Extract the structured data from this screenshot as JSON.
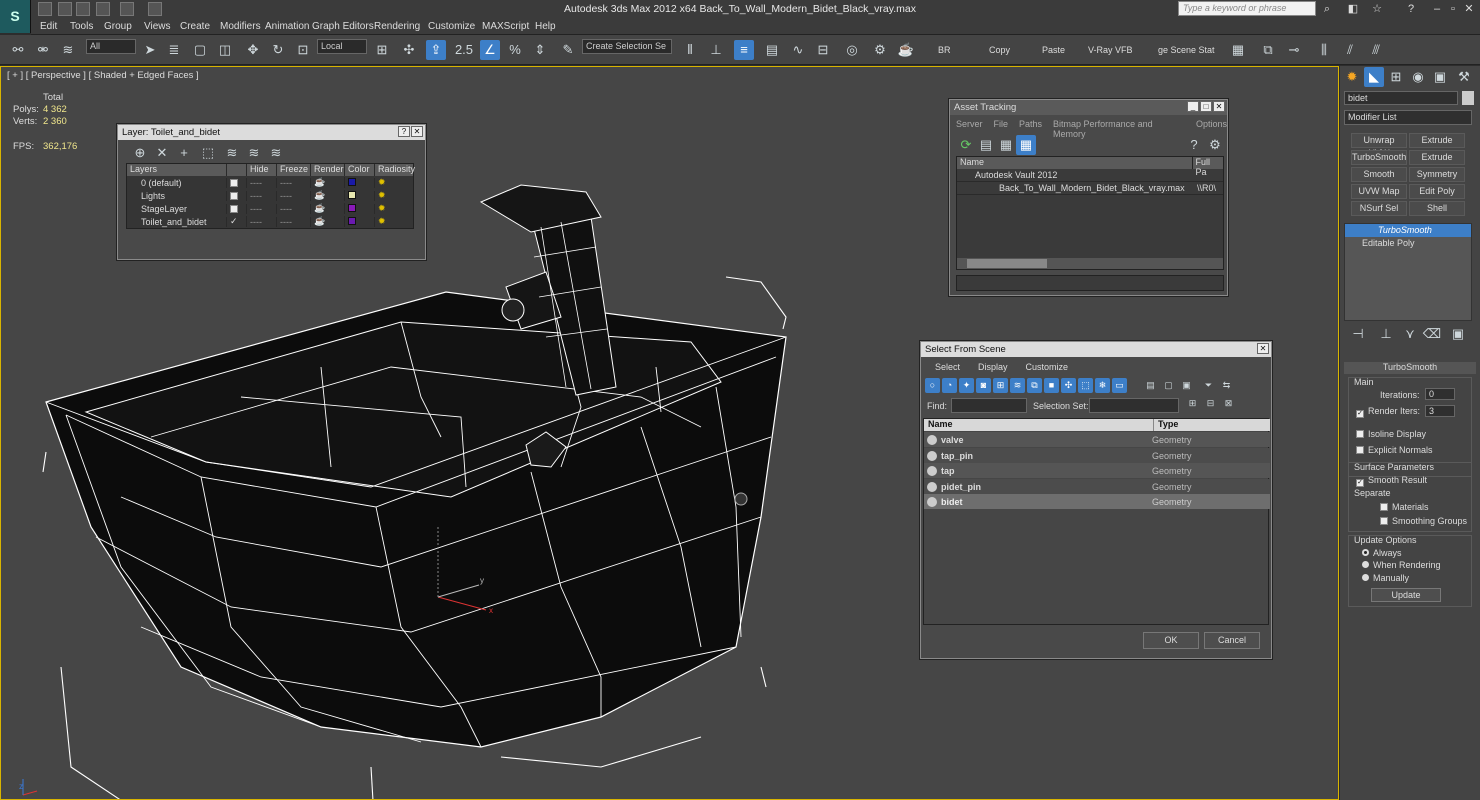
{
  "app": {
    "title": "Autodesk 3ds Max  2012 x64     Back_To_Wall_Modern_Bidet_Black_vray.max",
    "logo": "S",
    "search_placeholder": "Type a keyword or phrase"
  },
  "menu": [
    "Edit",
    "Tools",
    "Group",
    "Views",
    "Create",
    "Modifiers",
    "Animation",
    "Graph Editors",
    "Rendering",
    "Customize",
    "MAXScript",
    "Help"
  ],
  "toolbar": {
    "filter": "All",
    "coord": "Local",
    "snap_value": "2.5",
    "selection_set": "Create Selection Se",
    "labels": [
      "BR",
      "Copy",
      "Paste",
      "V-Ray VFB",
      "ge Scene Stat"
    ]
  },
  "viewport": {
    "label": "[ + ] [ Perspective ] [ Shaded + Edged Faces ]",
    "stats": {
      "header": "Total",
      "polys_label": "Polys:",
      "polys": "4 362",
      "verts_label": "Verts:",
      "verts": "2 360",
      "fps_label": "FPS:",
      "fps": "362,176"
    },
    "axis_labels": {
      "x": "x",
      "y": "y",
      "z": "z"
    }
  },
  "layer_dialog": {
    "title": "Layer: Toilet_and_bidet",
    "columns": [
      "Layers",
      "Hide",
      "Freeze",
      "Render",
      "Color",
      "Radiosity"
    ],
    "rows": [
      {
        "name": "0 (default)",
        "color": "#1a1aa8",
        "active": false
      },
      {
        "name": "Lights",
        "color": "#e8e8b0",
        "active": false
      },
      {
        "name": "StageLayer",
        "color": "#8a1ab8",
        "active": false
      },
      {
        "name": "Toilet_and_bidet",
        "color": "#6a1ab0",
        "active": true
      }
    ],
    "check": "✓"
  },
  "asset_tracking": {
    "title": "Asset Tracking",
    "menu": [
      "Server",
      "File",
      "Paths",
      "Bitmap Performance and Memory",
      "Options"
    ],
    "columns": [
      "Name",
      "Full Pa"
    ],
    "rows": [
      {
        "name": "Autodesk Vault 2012",
        "path": ""
      },
      {
        "name": "Back_To_Wall_Modern_Bidet_Black_vray.max",
        "path": "\\\\R0\\"
      }
    ]
  },
  "select_scene": {
    "title": "Select From Scene",
    "menu": [
      "Select",
      "Display",
      "Customize"
    ],
    "find_label": "Find:",
    "selection_set_label": "Selection Set:",
    "columns": [
      "Name",
      "Type"
    ],
    "rows": [
      {
        "name": "valve",
        "type": "Geometry",
        "selected": false
      },
      {
        "name": "tap_pin",
        "type": "Geometry",
        "selected": false
      },
      {
        "name": "tap",
        "type": "Geometry",
        "selected": false
      },
      {
        "name": "pidet_pin",
        "type": "Geometry",
        "selected": false
      },
      {
        "name": "bidet",
        "type": "Geometry",
        "selected": true
      }
    ],
    "ok": "OK",
    "cancel": "Cancel"
  },
  "command_panel": {
    "object_name": "bidet",
    "modifier_list": "Modifier List",
    "buttons": [
      "Unwrap UVW",
      "Extrude",
      "TurboSmooth",
      "Extrude",
      "Smooth",
      "Symmetry",
      "UVW Map",
      "Edit Poly",
      "NSurf Sel",
      "Shell"
    ],
    "stack": [
      "TurboSmooth",
      "Editable Poly"
    ],
    "rollout_title": "TurboSmooth",
    "main_label": "Main",
    "iterations_label": "Iterations:",
    "iterations": "0",
    "render_iters_label": "Render Iters:",
    "render_iters": "3",
    "isoline": "Isoline Display",
    "explicit_normals": "Explicit Normals",
    "surface_params": "Surface Parameters",
    "smooth_result": "Smooth Result",
    "separate": "Separate",
    "materials": "Materials",
    "smoothing_groups": "Smoothing Groups",
    "update_options": "Update Options",
    "always": "Always",
    "when_rendering": "When Rendering",
    "manually": "Manually",
    "update": "Update"
  }
}
